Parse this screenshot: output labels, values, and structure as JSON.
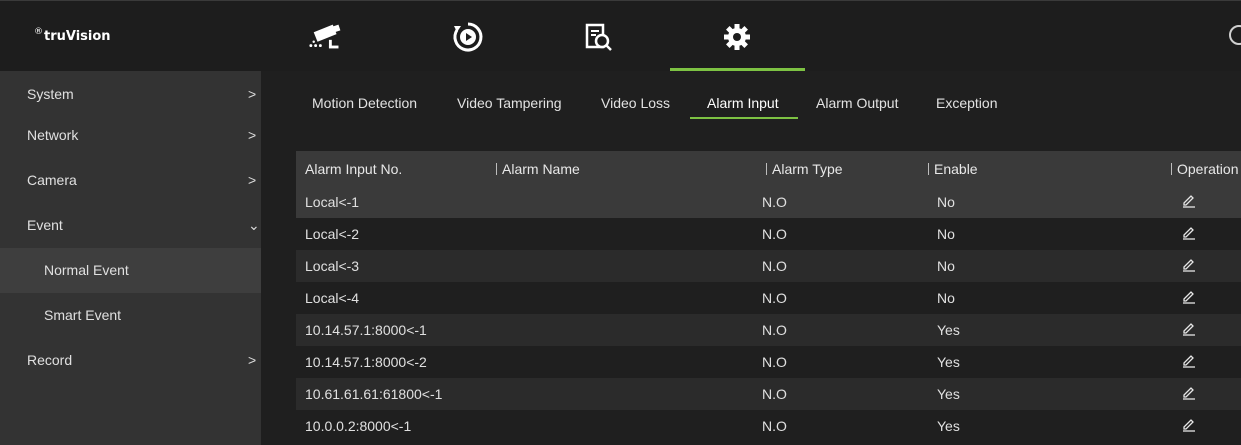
{
  "app": {
    "logo_mark": "®",
    "logo_text": "truVision",
    "accent_color": "#7dc243",
    "top_tabs": [
      {
        "icon": "camera-icon",
        "active": false
      },
      {
        "icon": "playback-icon",
        "active": false
      },
      {
        "icon": "search-file-icon",
        "active": false
      },
      {
        "icon": "gear-icon",
        "active": true
      }
    ],
    "help_icon": "help-icon"
  },
  "sidebar": {
    "items": [
      {
        "label": "System",
        "chevron": ">"
      },
      {
        "label": "Network",
        "chevron": ">"
      },
      {
        "label": "Camera",
        "chevron": ">"
      },
      {
        "label": "Event",
        "chevron": "⌄"
      },
      {
        "label": "Normal Event"
      },
      {
        "label": "Smart Event"
      },
      {
        "label": "Record",
        "chevron": ">"
      }
    ]
  },
  "subtabs": [
    "Motion Detection",
    "Video Tampering",
    "Video Loss",
    "Alarm Input",
    "Alarm Output",
    "Exception"
  ],
  "table": {
    "headers": [
      "Alarm Input No.",
      "Alarm Name",
      "Alarm Type",
      "Enable",
      "Operation"
    ],
    "rows": [
      {
        "no": "Local<-1",
        "name": "",
        "type": "N.O",
        "enable": "No"
      },
      {
        "no": "Local<-2",
        "name": "",
        "type": "N.O",
        "enable": "No"
      },
      {
        "no": "Local<-3",
        "name": "",
        "type": "N.O",
        "enable": "No"
      },
      {
        "no": "Local<-4",
        "name": "",
        "type": "N.O",
        "enable": "No"
      },
      {
        "no": "10.14.57.1:8000<-1",
        "name": "",
        "type": "N.O",
        "enable": "Yes"
      },
      {
        "no": "10.14.57.1:8000<-2",
        "name": "",
        "type": "N.O",
        "enable": "Yes"
      },
      {
        "no": "10.61.61.61:61800<-1",
        "name": "",
        "type": "N.O",
        "enable": "Yes"
      },
      {
        "no": "10.0.0.2:8000<-1",
        "name": "",
        "type": "N.O",
        "enable": "Yes"
      }
    ]
  }
}
